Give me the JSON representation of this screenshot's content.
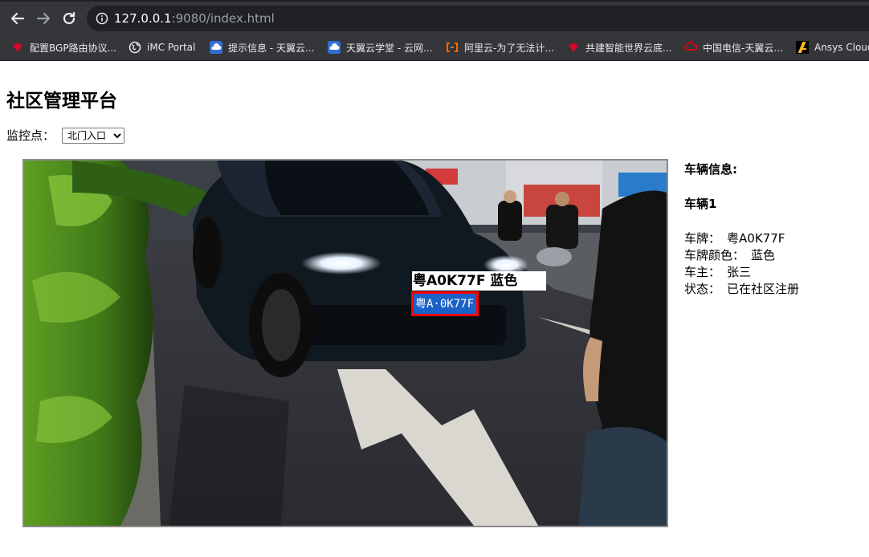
{
  "browser": {
    "url_host": "127.0.0.1",
    "url_rest": ":9080/index.html",
    "bookmarks": [
      {
        "label": "配置BGP路由协议...",
        "icon": "huawei-icon",
        "color": "#cf0a2c"
      },
      {
        "label": "iMC Portal",
        "icon": "globe-icon",
        "color": "#e8eaed"
      },
      {
        "label": "提示信息 - 天翼云...",
        "icon": "cloud-icon",
        "color": "#1e88e5"
      },
      {
        "label": "天翼云学堂 - 云网...",
        "icon": "cloud-icon",
        "color": "#1e88e5"
      },
      {
        "label": "阿里云-为了无法计...",
        "icon": "aliyun-icon",
        "color": "#ff6a00"
      },
      {
        "label": "共建智能世界云底...",
        "icon": "huawei-icon",
        "color": "#cf0a2c"
      },
      {
        "label": "中国电信-天翼云...",
        "icon": "cloud-red-icon",
        "color": "#e60012"
      },
      {
        "label": "Ansys Cloud",
        "icon": "ansys-icon",
        "color": "#ffb71b"
      }
    ]
  },
  "page": {
    "title": "社区管理平台",
    "monitor_label": "监控点：",
    "monitor_selected": "北门入口"
  },
  "camera": {
    "detection_caption": "粤A0K77F 蓝色",
    "plate_text": "粤A·0K77F",
    "box_color": "#ff0000"
  },
  "vehicle_info": {
    "title": "车辆信息:",
    "vehicle_heading": "车辆1",
    "rows": [
      {
        "label": "车牌：",
        "value": "粤A0K77F"
      },
      {
        "label": "车牌颜色：",
        "value": "蓝色"
      },
      {
        "label": "车主：",
        "value": "张三"
      },
      {
        "label": "状态：",
        "value": "已在社区注册"
      }
    ]
  }
}
